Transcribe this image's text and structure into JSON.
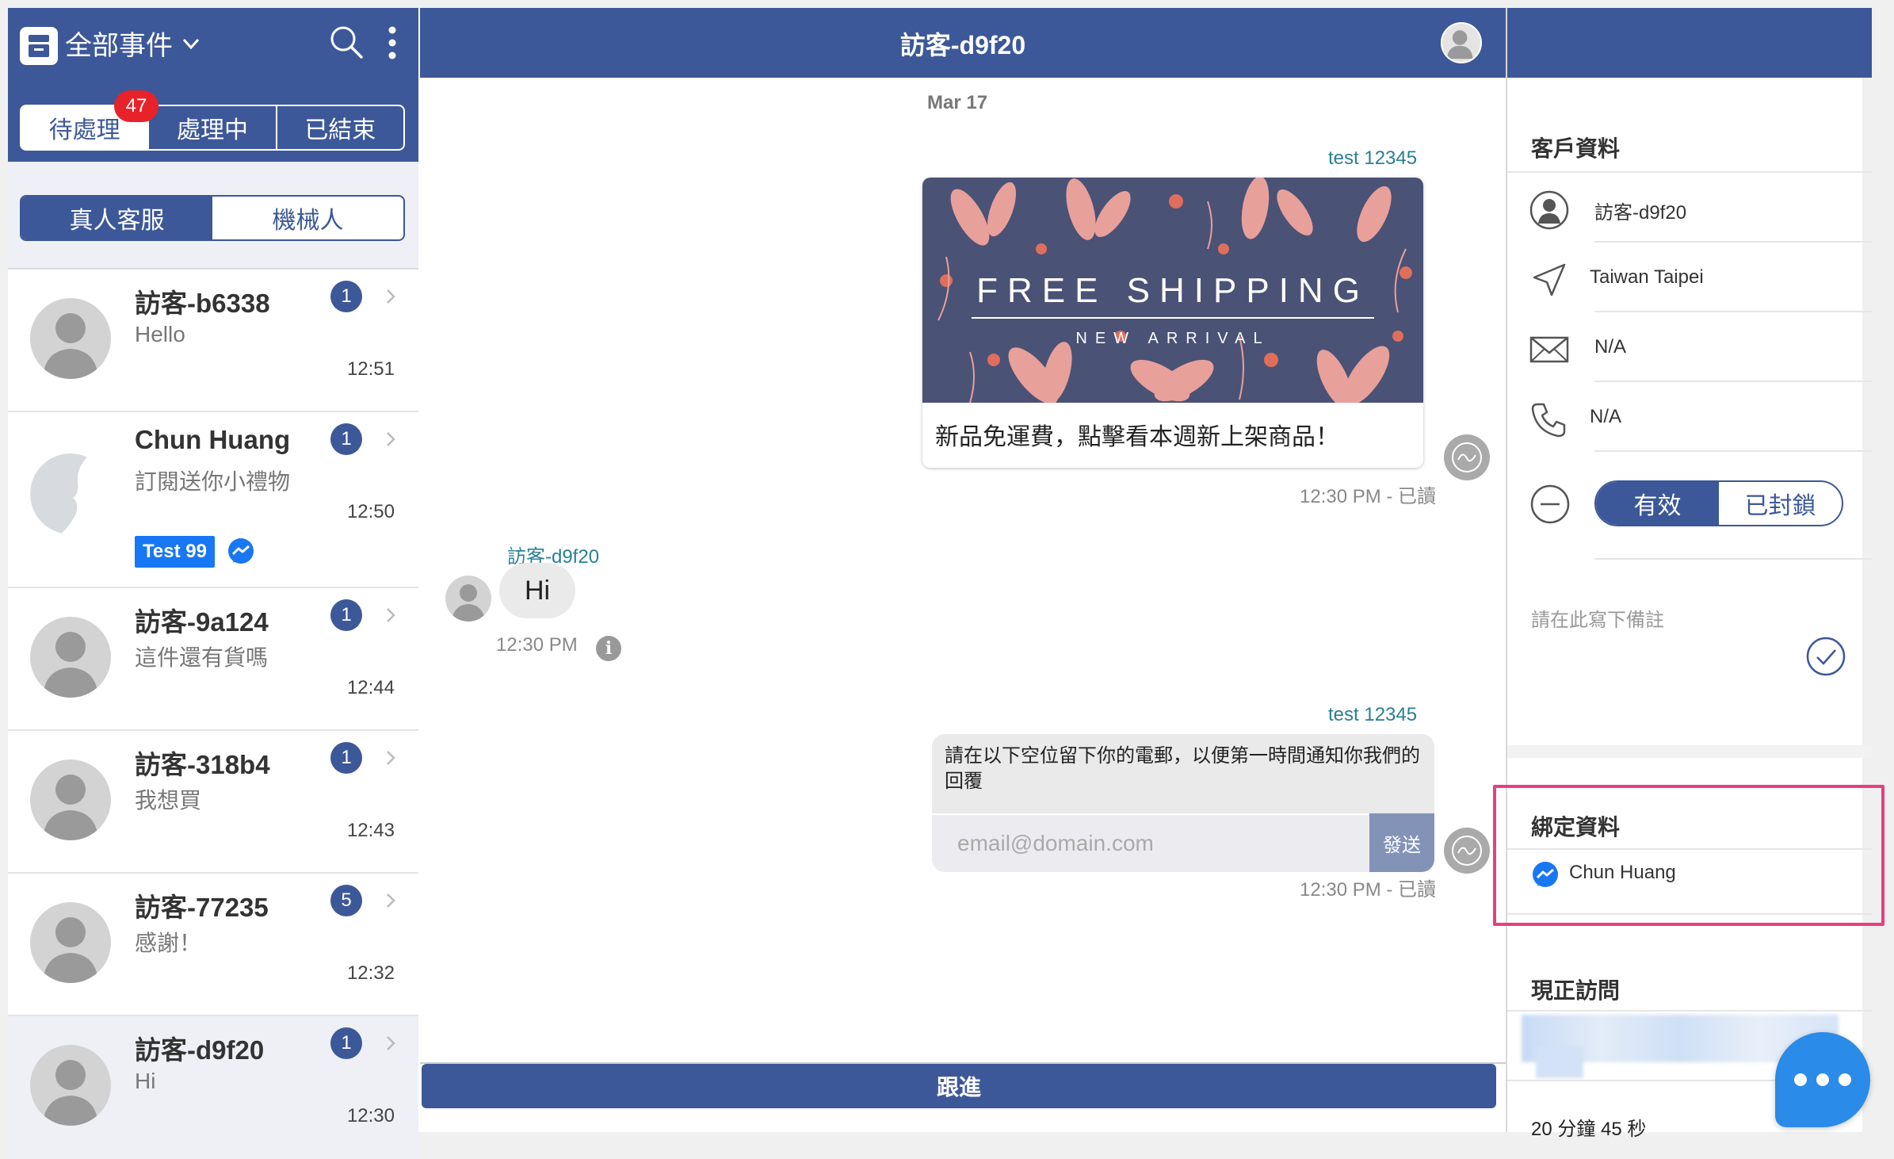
{
  "colors": {
    "brand": "#3c5898",
    "badge_red": "#e8222a",
    "highlight": "#e83f7e",
    "messenger": "#1877f2",
    "sender_teal": "#2a7f94"
  },
  "sidebar": {
    "filter_title": "全部事件",
    "status_tabs": [
      {
        "label": "待處理",
        "active": true
      },
      {
        "label": "處理中",
        "active": false
      },
      {
        "label": "已結束",
        "active": false
      }
    ],
    "pending_count": "47",
    "agent_tabs": [
      {
        "label": "真人客服",
        "active": true
      },
      {
        "label": "機械人",
        "active": false
      }
    ],
    "conversations": [
      {
        "name": "訪客-b6338",
        "preview": "Hello",
        "time": "12:51",
        "unread": "1"
      },
      {
        "name": "Chun Huang",
        "preview": "訂閱送你小禮物",
        "time": "12:50",
        "unread": "1",
        "tag": "Test 99",
        "tag_icon": "messenger-icon"
      },
      {
        "name": "訪客-9a124",
        "preview": "這件還有貨嗎",
        "time": "12:44",
        "unread": "1"
      },
      {
        "name": "訪客-318b4",
        "preview": "我想買",
        "time": "12:43",
        "unread": "1"
      },
      {
        "name": "訪客-77235",
        "preview": "感謝！",
        "time": "12:32",
        "unread": "5"
      },
      {
        "name": "訪客-d9f20",
        "preview": "Hi",
        "time": "12:30",
        "unread": "1",
        "selected": true
      }
    ]
  },
  "chat": {
    "title": "訪客-d9f20",
    "date": "Mar 17",
    "promo": {
      "sender": "test 12345",
      "image_title": "FREE SHIPPING",
      "image_subtitle": "NEW ARRIVAL",
      "caption": "新品免運費，點擊看本週新上架商品！",
      "meta": "12:30 PM - 已讀"
    },
    "visitor_msg": {
      "sender": "訪客-d9f20",
      "text": "Hi",
      "time": "12:30 PM"
    },
    "form": {
      "sender": "test 12345",
      "text": "請在以下空位留下你的電郵，以便第一時間通知你我們的回覆",
      "placeholder": "email@domain.com",
      "send_label": "發送",
      "meta": "12:30 PM - 已讀"
    },
    "followup_label": "跟進"
  },
  "profile": {
    "section_title": "客戶資料",
    "name": "訪客-d9f20",
    "location": "Taiwan Taipei",
    "email": "N/A",
    "phone": "N/A",
    "status_options": [
      {
        "label": "有效",
        "active": true
      },
      {
        "label": "已封鎖",
        "active": false
      }
    ],
    "note_placeholder": "請在此寫下備註",
    "bound_title": "綁定資料",
    "bound_name": "Chun Huang",
    "visiting_title": "現正訪問",
    "duration": "20 分鐘 45 秒"
  }
}
